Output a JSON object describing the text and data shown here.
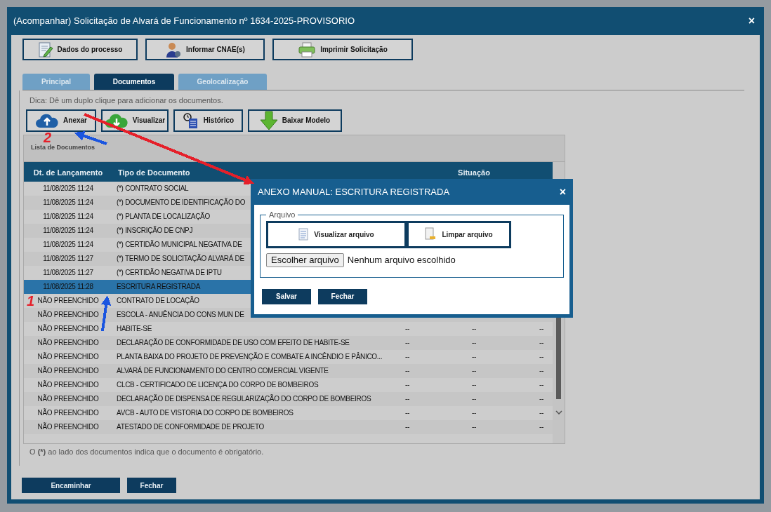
{
  "window": {
    "title": "(Acompanhar) Solicitação de Alvará de Funcionamento nº 1634-2025-PROVISORIO",
    "close": "×"
  },
  "toolbar": [
    {
      "label": "Dados do processo"
    },
    {
      "label": "Informar CNAE(s)"
    },
    {
      "label": "Imprimir Solicitação"
    }
  ],
  "tabs": [
    {
      "label": "Principal",
      "selected": false
    },
    {
      "label": "Documentos",
      "selected": true
    },
    {
      "label": "Geolocalização",
      "selected": false
    }
  ],
  "hint": "Dica: Dê um duplo clique para adicionar os documentos.",
  "actions": [
    {
      "label": "Anexar"
    },
    {
      "label": "Visualizar"
    },
    {
      "label": "Histórico"
    },
    {
      "label": "Baixar Modelo"
    }
  ],
  "list": {
    "title": "Lista de Documentos",
    "columns": [
      "Dt. de Lançamento",
      "Tipo de Documento",
      "",
      "Situação",
      ""
    ],
    "rows": [
      {
        "date": "11/08/2025 11:24",
        "type": "(*) CONTRATO SOCIAL",
        "selected": false
      },
      {
        "date": "11/08/2025 11:24",
        "type": "(*) DOCUMENTO DE IDENTIFICAÇÃO DO",
        "selected": false
      },
      {
        "date": "11/08/2025 11:24",
        "type": "(*) PLANTA DE LOCALIZAÇÃO",
        "selected": false
      },
      {
        "date": "11/08/2025 11:24",
        "type": "(*) INSCRIÇÃO DE CNPJ",
        "selected": false
      },
      {
        "date": "11/08/2025 11:24",
        "type": "(*) CERTIDÃO MUNICIPAL NEGATIVA DE",
        "selected": false
      },
      {
        "date": "11/08/2025 11:27",
        "type": "(*) TERMO DE SOLICITAÇÃO ALVARÁ DE",
        "selected": false
      },
      {
        "date": "11/08/2025 11:27",
        "type": "(*) CERTIDÃO NEGATIVA DE IPTU",
        "selected": false
      },
      {
        "date": "11/08/2025 11:28",
        "type": "ESCRITURA REGISTRADA",
        "selected": true
      },
      {
        "date": "NÃO PREENCHIDO",
        "type": "CONTRATO DE LOCAÇÃO",
        "selected": false
      },
      {
        "date": "NÃO PREENCHIDO",
        "type": "ESCOLA - ANUÊNCIA DO CONS MUN DE",
        "selected": false
      },
      {
        "date": "NÃO PREENCHIDO",
        "type": "HABITE-SE",
        "column_3": "--",
        "status": "--",
        "column_5": "--",
        "selected": false
      },
      {
        "date": "NÃO PREENCHIDO",
        "type": "DECLARAÇÃO DE CONFORMIDADE DE USO COM EFEITO DE HABITE-SE",
        "column_3": "--",
        "status": "--",
        "column_5": "--",
        "selected": false
      },
      {
        "date": "NÃO PREENCHIDO",
        "type": "PLANTA BAIXA DO PROJETO DE PREVENÇÃO E COMBATE A INCÊNDIO E PÂNICO...",
        "column_3": "--",
        "status": "--",
        "column_5": "--",
        "selected": false
      },
      {
        "date": "NÃO PREENCHIDO",
        "type": "ALVARÁ DE FUNCIONAMENTO DO CENTRO COMERCIAL VIGENTE",
        "column_3": "--",
        "status": "--",
        "column_5": "--",
        "selected": false
      },
      {
        "date": "NÃO PREENCHIDO",
        "type": "CLCB - CERTIFICADO DE LICENÇA DO CORPO DE BOMBEIROS",
        "column_3": "--",
        "status": "--",
        "column_5": "--",
        "selected": false
      },
      {
        "date": "NÃO PREENCHIDO",
        "type": "DECLARAÇÃO DE DISPENSA DE REGULARIZAÇÃO DO CORPO DE BOMBEIROS",
        "column_3": "--",
        "status": "--",
        "column_5": "--",
        "selected": false
      },
      {
        "date": "NÃO PREENCHIDO",
        "type": "AVCB - AUTO DE VISTORIA DO CORPO DE BOMBEIROS",
        "column_3": "--",
        "status": "--",
        "column_5": "--",
        "selected": false
      },
      {
        "date": "NÃO PREENCHIDO",
        "type": "ATESTADO DE CONFORMIDADE DE PROJETO",
        "column_3": "--",
        "status": "--",
        "column_5": "--",
        "selected": false
      }
    ]
  },
  "footnote": "O **(*)** ao lado dos documentos indica que o documento é obrigatório.",
  "footer_buttons": [
    "Encaminhar",
    "Fechar"
  ],
  "dialog": {
    "title": "ANEXO MANUAL: ESCRITURA REGISTRADA",
    "close": "×",
    "group": "Arquivo",
    "buttons": [
      {
        "label": "Visualizar arquivo"
      },
      {
        "label": "Limpar arquivo"
      }
    ],
    "file_button": "Escolher arquivo",
    "file_status": "Nenhum arquivo escolhido",
    "actions": [
      "Salvar",
      "Fechar"
    ]
  },
  "annotations": [
    {
      "kind": "arrow",
      "color": "#e5202a"
    },
    {
      "kind": "arrow",
      "color": "#1a55e0"
    },
    {
      "kind": "number",
      "label": "2",
      "color": "#e5202a"
    },
    {
      "kind": "number",
      "label": "1",
      "color": "#e5202a"
    },
    {
      "kind": "arrow",
      "color": "#1a55e0"
    }
  ]
}
